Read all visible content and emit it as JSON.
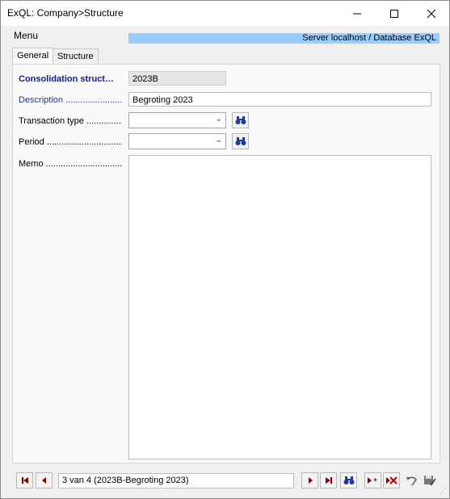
{
  "window": {
    "title": "ExQL: Company>Structure"
  },
  "menu": {
    "label": "Menu"
  },
  "server": {
    "text": "Server localhost / Database ExQL"
  },
  "tabs": [
    {
      "label": "General"
    },
    {
      "label": "Structure"
    }
  ],
  "form": {
    "consolidation": {
      "label": "Consolidation struct…",
      "value": "2023B"
    },
    "description": {
      "label": "Description .........................",
      "value": "Begroting 2023"
    },
    "transaction_type": {
      "label": "Transaction type ...............",
      "value": ""
    },
    "period": {
      "label": "Period ...................................",
      "value": ""
    },
    "memo": {
      "label": "Memo ....................................",
      "value": ""
    }
  },
  "navigator": {
    "record_text": "3 van 4 (2023B-Begroting 2023)"
  },
  "icons": {
    "find": "binoculars-icon",
    "first": "first-record-icon",
    "prev": "previous-record-icon",
    "next": "next-record-icon",
    "last": "last-record-icon",
    "new": "new-record-icon",
    "delete": "delete-record-icon",
    "undo": "undo-icon",
    "save": "save-icon"
  },
  "colors": {
    "server_bar": "#99ccff",
    "label_bold": "#1a1a8c",
    "label_blue": "#1f3a9c",
    "nav_arrow": "#8b0000"
  }
}
